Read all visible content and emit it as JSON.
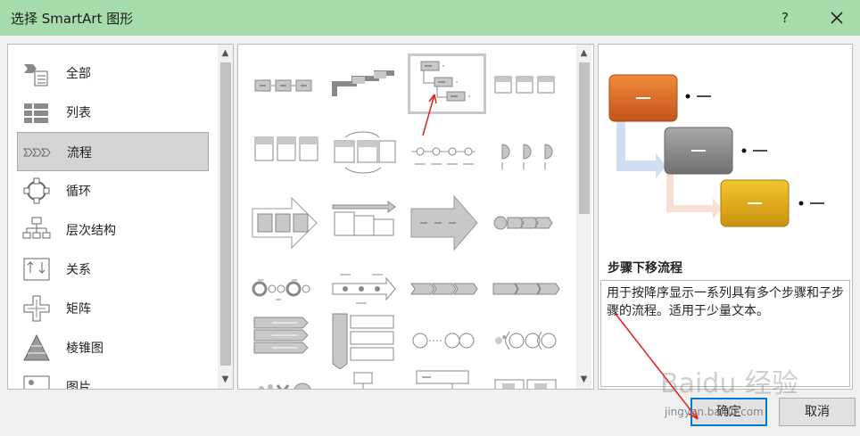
{
  "window": {
    "title": "选择 SmartArt 图形",
    "help": "?"
  },
  "categories": [
    {
      "label": "全部",
      "icon": "all-icon"
    },
    {
      "label": "列表",
      "icon": "list-icon"
    },
    {
      "label": "流程",
      "icon": "process-icon",
      "selected": true
    },
    {
      "label": "循环",
      "icon": "cycle-icon"
    },
    {
      "label": "层次结构",
      "icon": "hierarchy-icon"
    },
    {
      "label": "关系",
      "icon": "relationship-icon"
    },
    {
      "label": "矩阵",
      "icon": "matrix-icon"
    },
    {
      "label": "棱锥图",
      "icon": "pyramid-icon"
    },
    {
      "label": "图片",
      "icon": "picture-icon"
    }
  ],
  "preview": {
    "title": "步骤下移流程",
    "description": "用于按降序显示一系列具有多个步骤和子步骤的流程。适用于少量文本。",
    "colors": [
      "#d9631f",
      "#8a8a8a",
      "#e0a81a"
    ]
  },
  "buttons": {
    "ok": "确定",
    "cancel": "取消"
  },
  "watermark": {
    "text": "jingyan.baidu.com",
    "logo": "Baidu 经验"
  }
}
